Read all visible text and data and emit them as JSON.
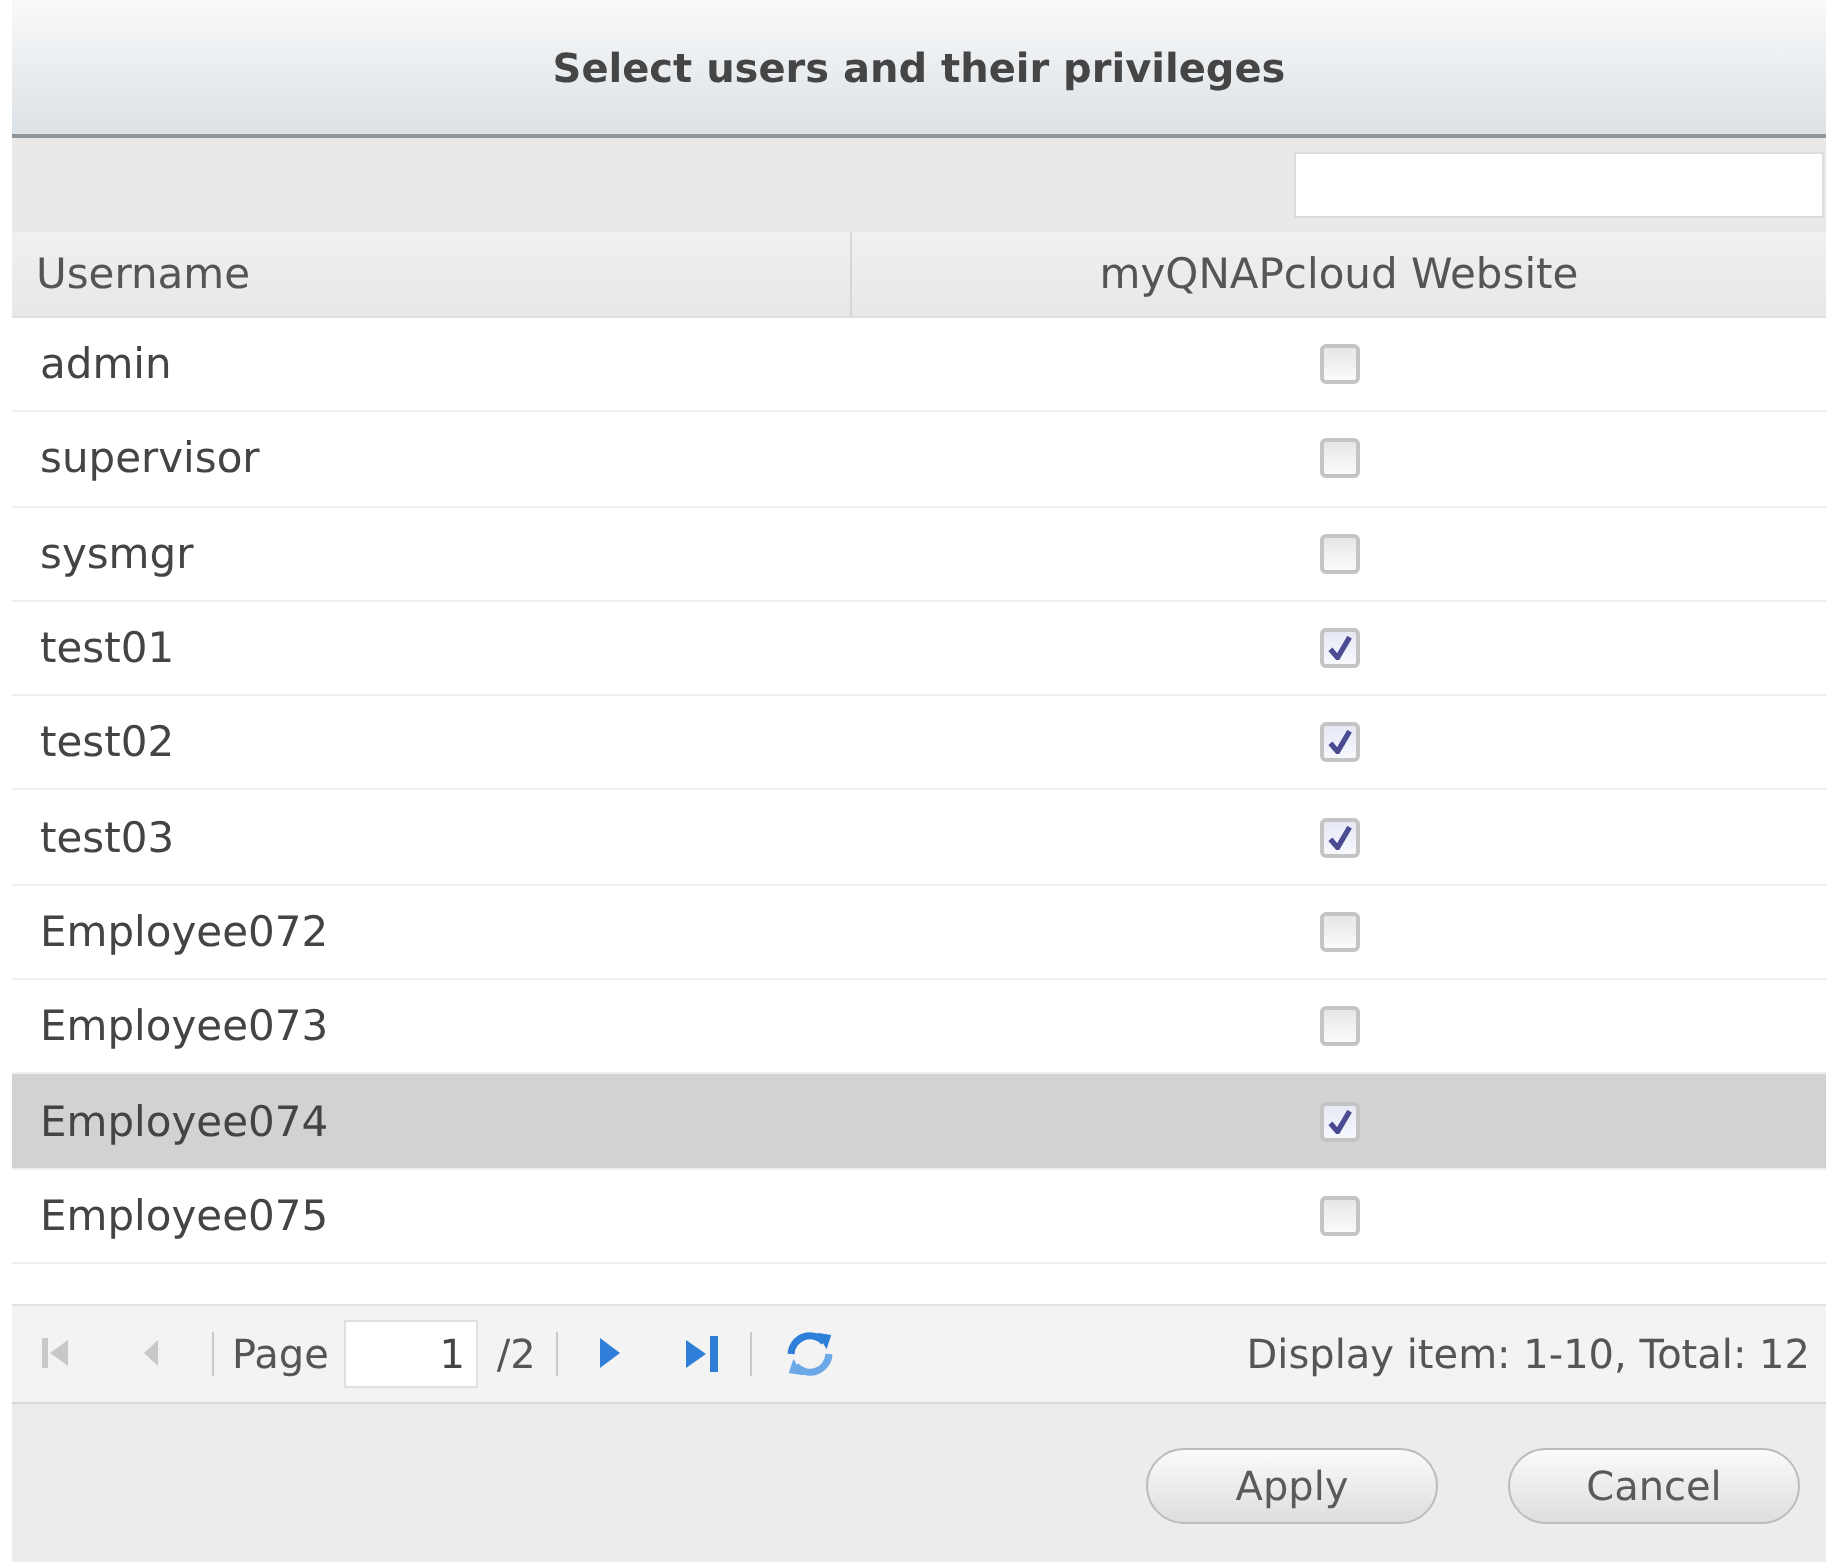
{
  "dialog": {
    "title": "Select users and their privileges"
  },
  "table": {
    "columns": [
      {
        "label": "Username"
      },
      {
        "label": "myQNAPcloud Website"
      }
    ],
    "rows": [
      {
        "username": "admin",
        "checked": false,
        "selected": false
      },
      {
        "username": "supervisor",
        "checked": false,
        "selected": false
      },
      {
        "username": "sysmgr",
        "checked": false,
        "selected": false
      },
      {
        "username": "test01",
        "checked": true,
        "selected": false
      },
      {
        "username": "test02",
        "checked": true,
        "selected": false
      },
      {
        "username": "test03",
        "checked": true,
        "selected": false
      },
      {
        "username": "Employee072",
        "checked": false,
        "selected": false
      },
      {
        "username": "Employee073",
        "checked": false,
        "selected": false
      },
      {
        "username": "Employee074",
        "checked": true,
        "selected": true
      },
      {
        "username": "Employee075",
        "checked": false,
        "selected": false
      }
    ]
  },
  "pagination": {
    "back_buttons": [
      {
        "kind": "first",
        "disabled": true
      },
      {
        "kind": "previous",
        "disabled": true
      }
    ],
    "page_label": "Page",
    "page": "1",
    "page_total": "/2",
    "forward_buttons": [
      {
        "kind": "next",
        "disabled": false
      },
      {
        "kind": "last",
        "disabled": false
      },
      {
        "kind": "refresh",
        "disabled": false
      }
    ],
    "status": "Display item: 1-10, Total: 12"
  },
  "buttons": [
    {
      "label": "Apply"
    },
    {
      "label": "Cancel"
    }
  ]
}
